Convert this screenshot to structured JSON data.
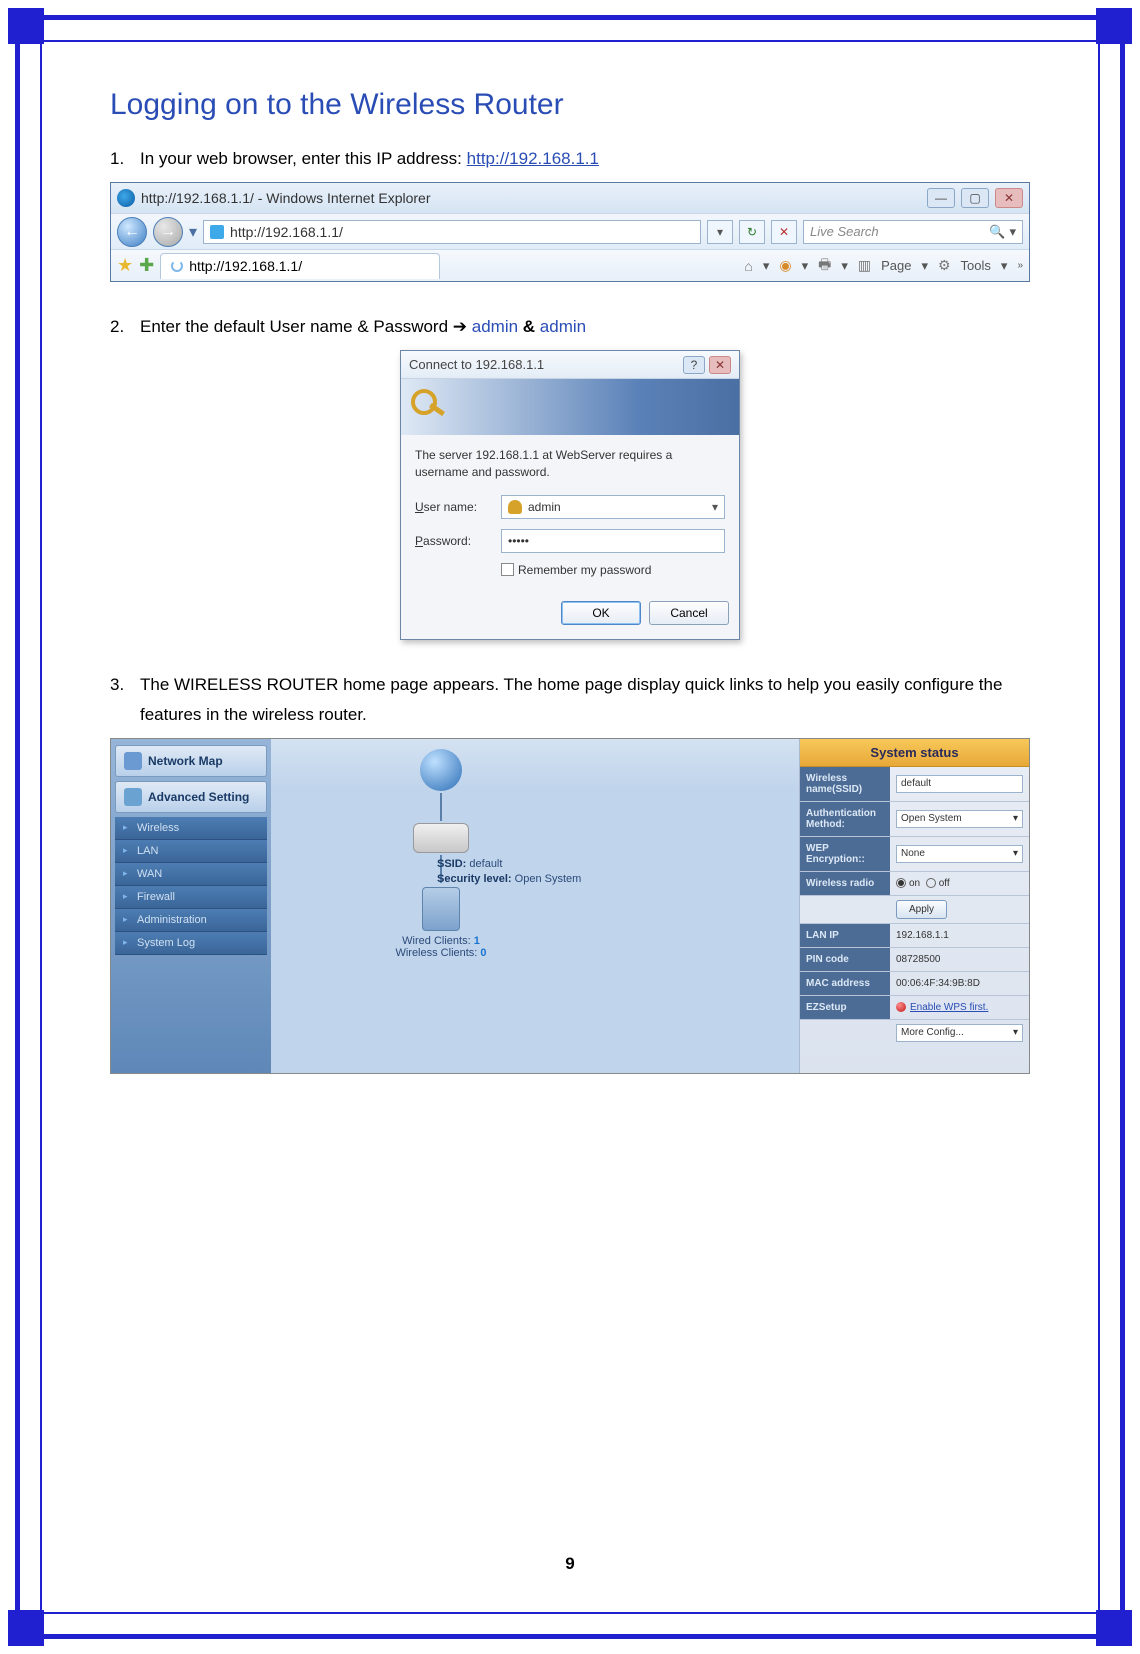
{
  "page_number": "9",
  "heading": "Logging on to the Wireless Router",
  "steps": {
    "s1": {
      "n": "1.",
      "text_a": "In your web browser, enter this IP address: ",
      "link": "http://192.168.1.1"
    },
    "s2": {
      "n": "2.",
      "text_a": "Enter the default User name & Password ",
      "arrow": "➔",
      "user": "admin",
      "amp": " & ",
      "pass": "admin"
    },
    "s3": {
      "n": "3.",
      "text": "The WIRELESS ROUTER home page appears. The home page display quick links to help you easily configure the features in the wireless router."
    }
  },
  "ie": {
    "title": "http://192.168.1.1/ - Windows Internet Explorer",
    "address": "http://192.168.1.1/",
    "search_placeholder": "Live Search",
    "tab_text": "http://192.168.1.1/",
    "tools": {
      "page": "Page",
      "tools": "Tools"
    },
    "winbtns": {
      "min": "—",
      "max": "▢",
      "close": "✕"
    },
    "refresh": "↻",
    "stop": "✕",
    "dd": "▾",
    "back": "←",
    "fwd": "→",
    "home": "⌂",
    "feed": "◉",
    "print": "🖶",
    "page_ico": "▥",
    "gear": "⚙",
    "chevrons": "»"
  },
  "dlg": {
    "title": "Connect to 192.168.1.1",
    "message": "The server 192.168.1.1 at WebServer requires a username and password.",
    "user_label_u": "U",
    "user_label_rest": "ser name:",
    "pass_label_u": "P",
    "pass_label_rest": "assword:",
    "username": "admin",
    "password": "•••••",
    "remember_u": "R",
    "remember_rest": "emember my password",
    "ok": "OK",
    "cancel": "Cancel",
    "help": "?",
    "close": "✕",
    "dd": "▾"
  },
  "router": {
    "side": {
      "map": "Network Map",
      "adv": "Advanced Setting",
      "items": [
        "Wireless",
        "LAN",
        "WAN",
        "Firewall",
        "Administration",
        "System Log"
      ]
    },
    "diagram": {
      "ssid_label": "SSID:",
      "ssid": "default",
      "sec_label": "Security level:",
      "sec": "Open System",
      "wired_label": "Wired Clients:",
      "wired": "1",
      "wireless_label": "Wireless Clients:",
      "wireless": "0"
    },
    "status": {
      "title": "System status",
      "rows": {
        "ssid_l": "Wireless name(SSID)",
        "ssid_v": "default",
        "auth_l": "Authentication Method:",
        "auth_v": "Open System",
        "wep_l": "WEP Encryption::",
        "wep_v": "None",
        "radio_l": "Wireless radio",
        "on": "on",
        "off": "off",
        "apply": "Apply",
        "lan_l": "LAN IP",
        "lan_v": "192.168.1.1",
        "pin_l": "PIN code",
        "pin_v": "08728500",
        "mac_l": "MAC address",
        "mac_v": "00:06:4F:34:9B:8D",
        "ez_l": "EZSetup",
        "ez_link": "Enable WPS first.",
        "more": "More Config..."
      },
      "dd": "▾"
    }
  }
}
